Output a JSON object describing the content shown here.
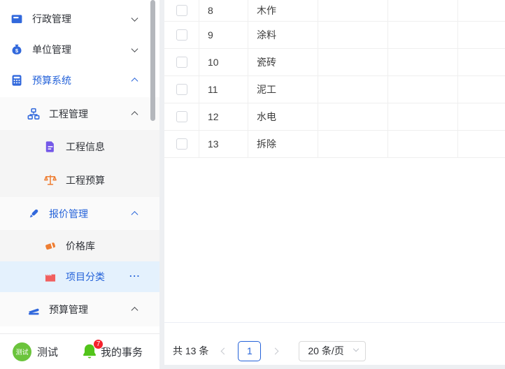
{
  "colors": {
    "primary_blue": "#2462d9",
    "selected_item_bg": "#e4f1fd",
    "submenu_bg_level2": "#fafafa",
    "submenu_bg_level3": "#f5f5f5",
    "table_border": "#efefef",
    "badge_red": "#f5222d",
    "bell_green": "#52c41a",
    "avatar_green": "#6bc43c",
    "icon_orange": "#ee7e33",
    "icon_purple": "#7458e8",
    "icon_coral": "#f15f5f"
  },
  "sidebar": {
    "items": [
      {
        "label": "行政管理",
        "icon": "archive-icon",
        "level": 1,
        "chevron": "chevron-down-icon",
        "active": false
      },
      {
        "label": "单位管理",
        "icon": "moneybag-icon",
        "level": 1,
        "chevron": "chevron-down-icon",
        "active": false
      },
      {
        "label": "预算系统",
        "icon": "calculator-icon",
        "level": 1,
        "chevron": "chevron-up-icon",
        "active": true
      },
      {
        "label": "工程管理",
        "icon": "sitemap-icon",
        "level": 2,
        "chevron": "chevron-up-icon",
        "active": false
      },
      {
        "label": "工程信息",
        "icon": "document-icon",
        "level": 3,
        "chevron": null,
        "active": false
      },
      {
        "label": "工程预算",
        "icon": "scale-icon",
        "level": 3,
        "chevron": null,
        "active": false
      },
      {
        "label": "报价管理",
        "icon": "pen-icon",
        "level": 2,
        "chevron": "chevron-up-icon",
        "active": true
      },
      {
        "label": "价格库",
        "icon": "eraser-icon",
        "level": 3,
        "chevron": null,
        "active": false
      },
      {
        "label": "项目分类",
        "icon": "factory-icon",
        "level": 3,
        "chevron": null,
        "active": true,
        "selected": true,
        "more_label": "···"
      },
      {
        "label": "预算管理",
        "icon": "stapler-icon",
        "level": 2,
        "chevron": "chevron-up-icon",
        "active": false
      }
    ],
    "footer": {
      "avatar_text": "测试",
      "user_name": "测试",
      "tasks_label": "我的事务",
      "badge": "7",
      "tasks_icon": "bell-icon"
    }
  },
  "table": {
    "rows": [
      {
        "id": "8",
        "name": "木作"
      },
      {
        "id": "9",
        "name": "涂料"
      },
      {
        "id": "10",
        "name": "瓷砖"
      },
      {
        "id": "11",
        "name": "泥工"
      },
      {
        "id": "12",
        "name": "水电"
      },
      {
        "id": "13",
        "name": "拆除"
      }
    ]
  },
  "pagination": {
    "total_label": "共 13 条",
    "current_page": "1",
    "page_size_label": "20 条/页",
    "prev_icon": "chevron-left-icon",
    "next_icon": "chevron-right-icon",
    "size_dropdown_icon": "chevron-down-icon"
  }
}
